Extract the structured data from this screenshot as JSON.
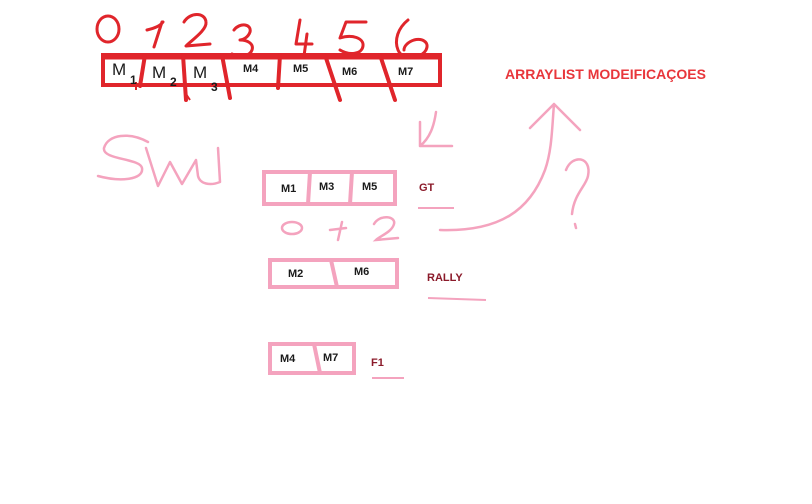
{
  "title": "ARRAYLIST MODEIFICAÇOES",
  "main_array": {
    "indices": [
      "0",
      "1",
      "2",
      "3",
      "4",
      "5",
      "6"
    ],
    "cells": [
      {
        "letter": "M",
        "sub": "1"
      },
      {
        "letter": "M",
        "sub": "2"
      },
      {
        "letter": "M",
        "sub": "3"
      },
      {
        "label": "M4"
      },
      {
        "label": "M5"
      },
      {
        "label": "M6"
      },
      {
        "label": "M7"
      }
    ]
  },
  "scribble": "SW",
  "groups": [
    {
      "name": "GT",
      "items": [
        "M1",
        "M3",
        "M5"
      ],
      "indices": [
        "0",
        "1",
        "2"
      ]
    },
    {
      "name": "RALLY",
      "items": [
        "M2",
        "M6"
      ]
    },
    {
      "name": "F1",
      "items": [
        "M4",
        "M7"
      ]
    }
  ],
  "question_mark": "?",
  "colors": {
    "red": "#e0252b",
    "pink": "#f4a3be",
    "label_red": "#8b1a2a",
    "title_red": "#e8363b"
  }
}
